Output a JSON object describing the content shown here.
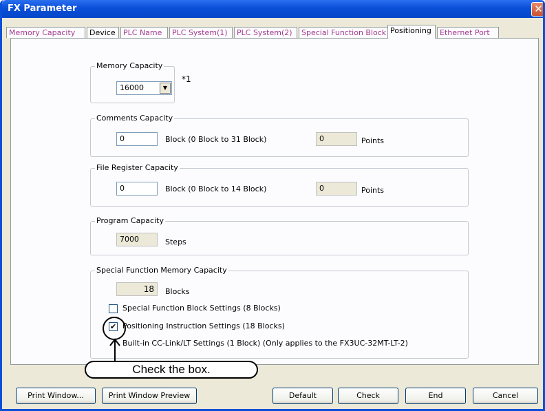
{
  "window": {
    "title": "FX Parameter",
    "close_glyph": "✕"
  },
  "tabs": [
    {
      "label": "Memory Capacity"
    },
    {
      "label": "Device"
    },
    {
      "label": "PLC Name"
    },
    {
      "label": "PLC System(1)"
    },
    {
      "label": "PLC System(2)"
    },
    {
      "label": "Special Function Block"
    },
    {
      "label": "Positioning"
    },
    {
      "label": "Ethernet Port"
    }
  ],
  "memory_capacity": {
    "legend": "Memory Capacity",
    "value": "16000",
    "note": "*1",
    "arrow_glyph": "▼"
  },
  "comments_capacity": {
    "legend": "Comments Capacity",
    "value": "0",
    "range": "Block (0 Block to 31 Block)",
    "points_value": "0",
    "points_unit": "Points"
  },
  "file_register_capacity": {
    "legend": "File Register Capacity",
    "value": "0",
    "range": "Block (0 Block to 14 Block)",
    "points_value": "0",
    "points_unit": "Points"
  },
  "program_capacity": {
    "legend": "Program Capacity",
    "value": "7000",
    "unit": "Steps"
  },
  "special_function": {
    "legend": "Special Function Memory Capacity",
    "value": "18",
    "unit": "Blocks",
    "options": [
      {
        "label": "Special Function Block Settings (8 Blocks)",
        "checked": false,
        "mark": ""
      },
      {
        "label": "Positioning Instruction Settings (18 Blocks)",
        "checked": true,
        "mark": "✔"
      },
      {
        "label": "Built-in CC-Link/LT Settings (1 Block) (Only applies to the FX3UC-32MT-LT-2)",
        "checked": false,
        "mark": ""
      }
    ]
  },
  "annotation": {
    "text": "Check the box."
  },
  "buttons": {
    "print_window": "Print Window...",
    "print_preview": "Print Window Preview",
    "default": "Default",
    "check": "Check",
    "end": "End",
    "cancel": "Cancel"
  }
}
